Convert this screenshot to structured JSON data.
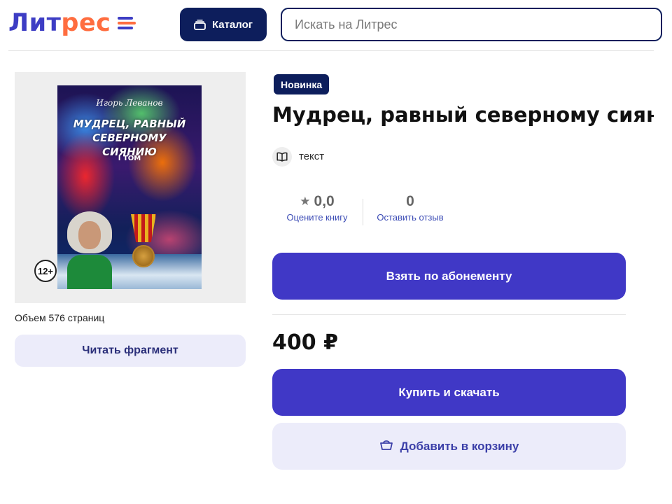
{
  "header": {
    "logo_part1": "Лит",
    "logo_part2": "рес",
    "catalog_label": "Каталог",
    "search_placeholder": "Искать на Литрес"
  },
  "book": {
    "cover": {
      "author": "Игорь Леванов",
      "title": "МУДРЕЦ, РАВНЫЙ СЕВЕРНОМУ СИЯНИЮ",
      "volume": "I ТОМ"
    },
    "age_rating": "12+",
    "pages_text": "Объем 576 страниц",
    "read_fragment_label": "Читать фрагмент",
    "badge": "Новинка",
    "title": "Мудрец, равный северному сиянию",
    "type_label": "текст",
    "rating_value": "0,0",
    "rating_label": "Оцените книгу",
    "reviews_count": "0",
    "reviews_label": "Оставить отзыв",
    "subscription_label": "Взять по абонементу",
    "price": "400 ₽",
    "buy_label": "Купить и скачать",
    "cart_label": "Добавить в корзину"
  },
  "colors": {
    "brand_blue": "#3d3dc4",
    "brand_orange": "#ff6d3f",
    "navy": "#0d1e5c",
    "primary_button": "#4038c6",
    "secondary_button": "#ececfa"
  },
  "icons": {
    "catalog": "stack-icon",
    "type": "book-icon",
    "rating": "star-icon",
    "cart": "basket-icon",
    "logo": "literes-logo-icon"
  }
}
